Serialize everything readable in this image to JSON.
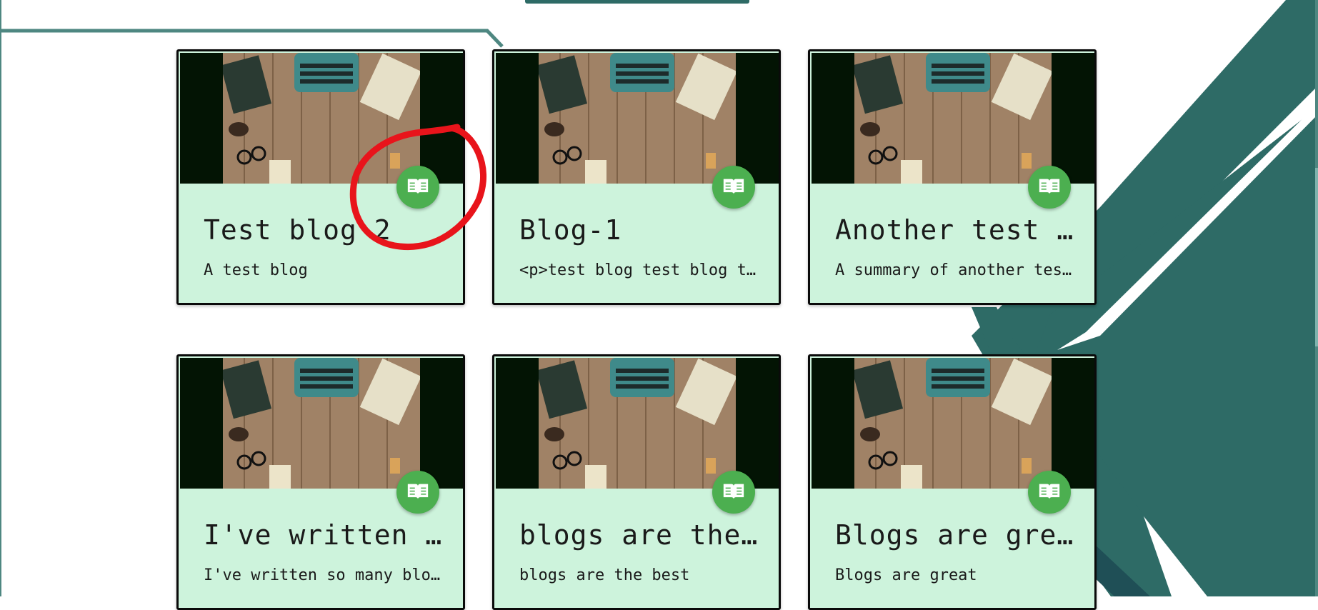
{
  "accent_color": "#2e6b66",
  "card_background": "#cdf3dc",
  "button_color": "#4caf50",
  "annotation_color": "#e8141b",
  "read_icon": "open-book-icon",
  "blogs": [
    {
      "title": "Test blog 2",
      "summary": "A test blog"
    },
    {
      "title": "Blog-1",
      "summary": "<p>test blog test blog test blog</p>"
    },
    {
      "title": "Another test blog",
      "summary": "A summary of another test blog"
    },
    {
      "title": "I've written so many blogs",
      "summary": "I've written so many blogs"
    },
    {
      "title": "blogs are the best",
      "summary": "blogs are the best"
    },
    {
      "title": "Blogs are great",
      "summary": "Blogs are great"
    }
  ]
}
